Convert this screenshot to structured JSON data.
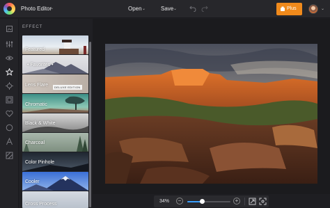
{
  "header": {
    "app_title": "Photo Editor",
    "open_label": "Open",
    "save_label": "Save",
    "plus_label": "Plus",
    "caret": "⌄",
    "accent_color": "#f08a1c"
  },
  "rail": {
    "icons": [
      "crop-icon",
      "adjust-icon",
      "eye-icon",
      "star-icon",
      "touchup-icon",
      "frame-icon",
      "heart-icon",
      "circle-icon",
      "text-icon",
      "texture-icon"
    ]
  },
  "panel": {
    "title": "EFFECT",
    "effects": [
      {
        "label": "Featured"
      },
      {
        "label": "• Favorites •"
      },
      {
        "label": "Lens Flare",
        "badge": "DELUXE EDITION"
      },
      {
        "label": "Chromatic"
      },
      {
        "label": "Black & White"
      },
      {
        "label": "Charcoal"
      },
      {
        "label": "Color Pinhole"
      },
      {
        "label": "Cooler"
      },
      {
        "label": "Cross Process"
      }
    ]
  },
  "zoom": {
    "value_label": "34%",
    "minus": "−",
    "plus": "+",
    "level": 0.34,
    "track_color": "#3aa0ff"
  }
}
